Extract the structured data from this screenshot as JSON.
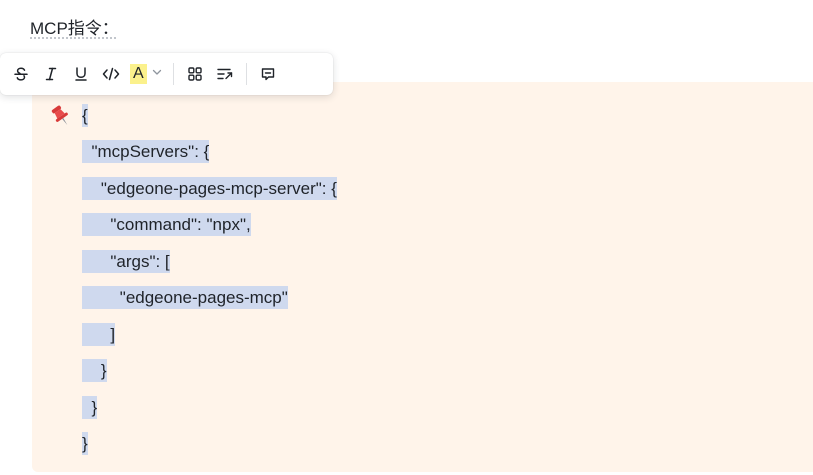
{
  "document": {
    "label": "MCP指令："
  },
  "toolbar": {
    "items": [
      {
        "icon": "strikethrough-icon"
      },
      {
        "icon": "italic-icon"
      },
      {
        "icon": "underline-icon"
      },
      {
        "icon": "inline-code-icon"
      },
      {
        "icon": "text-color-icon",
        "label": "A",
        "highlight_color": "#fbf18c"
      },
      {
        "icon": "chevron-down-icon"
      },
      {
        "icon": "block-grid-icon"
      },
      {
        "icon": "wrap-text-icon"
      },
      {
        "icon": "comment-icon"
      }
    ]
  },
  "callout": {
    "background": "#fff4ea",
    "icon": "pushpin-icon",
    "selection_color": "#cfd9ee",
    "lines": [
      "{",
      "  \"mcpServers\": {",
      "    \"edgeone-pages-mcp-server\": {",
      "      \"command\": \"npx\",",
      "      \"args\": [",
      "        \"edgeone-pages-mcp\"",
      "      ]",
      "    }",
      "  }",
      "}"
    ]
  }
}
